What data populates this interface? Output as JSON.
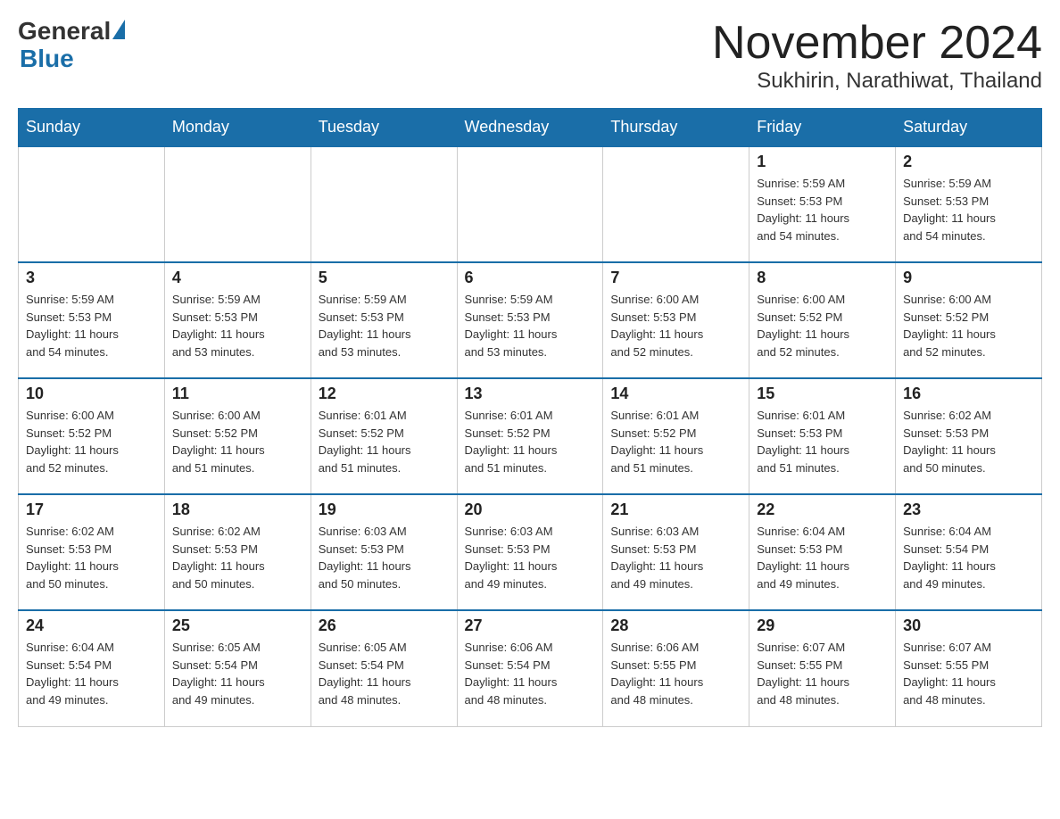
{
  "logo": {
    "general": "General",
    "blue": "Blue"
  },
  "title": {
    "month": "November 2024",
    "location": "Sukhirin, Narathiwat, Thailand"
  },
  "days_of_week": [
    "Sunday",
    "Monday",
    "Tuesday",
    "Wednesday",
    "Thursday",
    "Friday",
    "Saturday"
  ],
  "weeks": [
    [
      {
        "day": "",
        "info": ""
      },
      {
        "day": "",
        "info": ""
      },
      {
        "day": "",
        "info": ""
      },
      {
        "day": "",
        "info": ""
      },
      {
        "day": "",
        "info": ""
      },
      {
        "day": "1",
        "info": "Sunrise: 5:59 AM\nSunset: 5:53 PM\nDaylight: 11 hours\nand 54 minutes."
      },
      {
        "day": "2",
        "info": "Sunrise: 5:59 AM\nSunset: 5:53 PM\nDaylight: 11 hours\nand 54 minutes."
      }
    ],
    [
      {
        "day": "3",
        "info": "Sunrise: 5:59 AM\nSunset: 5:53 PM\nDaylight: 11 hours\nand 54 minutes."
      },
      {
        "day": "4",
        "info": "Sunrise: 5:59 AM\nSunset: 5:53 PM\nDaylight: 11 hours\nand 53 minutes."
      },
      {
        "day": "5",
        "info": "Sunrise: 5:59 AM\nSunset: 5:53 PM\nDaylight: 11 hours\nand 53 minutes."
      },
      {
        "day": "6",
        "info": "Sunrise: 5:59 AM\nSunset: 5:53 PM\nDaylight: 11 hours\nand 53 minutes."
      },
      {
        "day": "7",
        "info": "Sunrise: 6:00 AM\nSunset: 5:53 PM\nDaylight: 11 hours\nand 52 minutes."
      },
      {
        "day": "8",
        "info": "Sunrise: 6:00 AM\nSunset: 5:52 PM\nDaylight: 11 hours\nand 52 minutes."
      },
      {
        "day": "9",
        "info": "Sunrise: 6:00 AM\nSunset: 5:52 PM\nDaylight: 11 hours\nand 52 minutes."
      }
    ],
    [
      {
        "day": "10",
        "info": "Sunrise: 6:00 AM\nSunset: 5:52 PM\nDaylight: 11 hours\nand 52 minutes."
      },
      {
        "day": "11",
        "info": "Sunrise: 6:00 AM\nSunset: 5:52 PM\nDaylight: 11 hours\nand 51 minutes."
      },
      {
        "day": "12",
        "info": "Sunrise: 6:01 AM\nSunset: 5:52 PM\nDaylight: 11 hours\nand 51 minutes."
      },
      {
        "day": "13",
        "info": "Sunrise: 6:01 AM\nSunset: 5:52 PM\nDaylight: 11 hours\nand 51 minutes."
      },
      {
        "day": "14",
        "info": "Sunrise: 6:01 AM\nSunset: 5:52 PM\nDaylight: 11 hours\nand 51 minutes."
      },
      {
        "day": "15",
        "info": "Sunrise: 6:01 AM\nSunset: 5:53 PM\nDaylight: 11 hours\nand 51 minutes."
      },
      {
        "day": "16",
        "info": "Sunrise: 6:02 AM\nSunset: 5:53 PM\nDaylight: 11 hours\nand 50 minutes."
      }
    ],
    [
      {
        "day": "17",
        "info": "Sunrise: 6:02 AM\nSunset: 5:53 PM\nDaylight: 11 hours\nand 50 minutes."
      },
      {
        "day": "18",
        "info": "Sunrise: 6:02 AM\nSunset: 5:53 PM\nDaylight: 11 hours\nand 50 minutes."
      },
      {
        "day": "19",
        "info": "Sunrise: 6:03 AM\nSunset: 5:53 PM\nDaylight: 11 hours\nand 50 minutes."
      },
      {
        "day": "20",
        "info": "Sunrise: 6:03 AM\nSunset: 5:53 PM\nDaylight: 11 hours\nand 49 minutes."
      },
      {
        "day": "21",
        "info": "Sunrise: 6:03 AM\nSunset: 5:53 PM\nDaylight: 11 hours\nand 49 minutes."
      },
      {
        "day": "22",
        "info": "Sunrise: 6:04 AM\nSunset: 5:53 PM\nDaylight: 11 hours\nand 49 minutes."
      },
      {
        "day": "23",
        "info": "Sunrise: 6:04 AM\nSunset: 5:54 PM\nDaylight: 11 hours\nand 49 minutes."
      }
    ],
    [
      {
        "day": "24",
        "info": "Sunrise: 6:04 AM\nSunset: 5:54 PM\nDaylight: 11 hours\nand 49 minutes."
      },
      {
        "day": "25",
        "info": "Sunrise: 6:05 AM\nSunset: 5:54 PM\nDaylight: 11 hours\nand 49 minutes."
      },
      {
        "day": "26",
        "info": "Sunrise: 6:05 AM\nSunset: 5:54 PM\nDaylight: 11 hours\nand 48 minutes."
      },
      {
        "day": "27",
        "info": "Sunrise: 6:06 AM\nSunset: 5:54 PM\nDaylight: 11 hours\nand 48 minutes."
      },
      {
        "day": "28",
        "info": "Sunrise: 6:06 AM\nSunset: 5:55 PM\nDaylight: 11 hours\nand 48 minutes."
      },
      {
        "day": "29",
        "info": "Sunrise: 6:07 AM\nSunset: 5:55 PM\nDaylight: 11 hours\nand 48 minutes."
      },
      {
        "day": "30",
        "info": "Sunrise: 6:07 AM\nSunset: 5:55 PM\nDaylight: 11 hours\nand 48 minutes."
      }
    ]
  ]
}
